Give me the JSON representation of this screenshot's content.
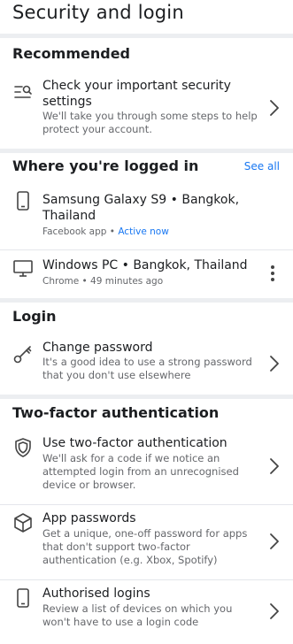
{
  "page": {
    "title": "Security and login"
  },
  "recommended": {
    "heading": "Recommended",
    "item": {
      "title": "Check your important security settings",
      "subtitle": "We'll take you through some steps to help protect your account."
    }
  },
  "logged_in": {
    "heading": "Where you're logged in",
    "see_all": "See all",
    "sessions": [
      {
        "device": "Samsung Galaxy S9 • Bangkok, Thailand",
        "app": "Facebook app • ",
        "status": "Active now",
        "icon": "phone-icon"
      },
      {
        "device": "Windows PC • Bangkok, Thailand",
        "app": "Chrome • 49 minutes ago",
        "icon": "monitor-icon"
      }
    ]
  },
  "login": {
    "heading": "Login",
    "item": {
      "title": "Change password",
      "subtitle": "It's a good idea to use a strong password that you don't use elsewhere",
      "icon": "key-icon"
    }
  },
  "two_factor": {
    "heading": "Two-factor authentication",
    "items": [
      {
        "title": "Use two-factor authentication",
        "subtitle": "We'll ask for a code if we notice an attempted login from an unrecognised device or browser.",
        "icon": "shield-icon"
      },
      {
        "title": "App passwords",
        "subtitle": "Get a unique, one-off password for apps that don't support two-factor authentication (e.g. Xbox, Spotify)",
        "icon": "cube-icon"
      },
      {
        "title": "Authorised logins",
        "subtitle": "Review a list of devices on which you won't have to use a login code",
        "icon": "phone-icon"
      }
    ]
  },
  "colors": {
    "accent": "#1877f2",
    "text": "#1c1e21",
    "secondary": "#65676b",
    "divider": "#eceef1"
  }
}
